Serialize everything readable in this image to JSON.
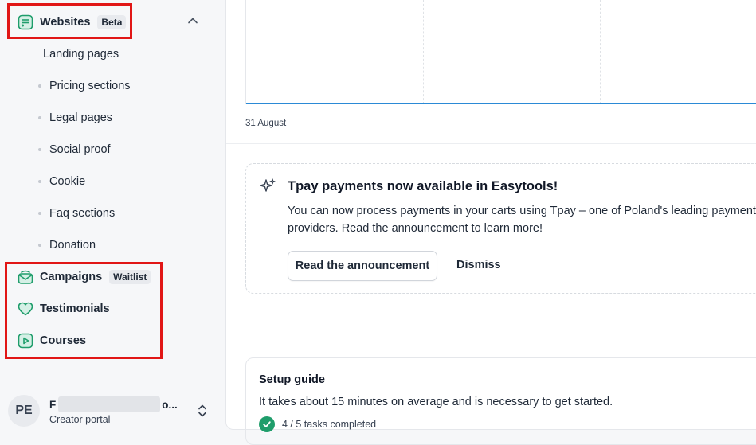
{
  "sidebar": {
    "websites": {
      "label": "Websites",
      "badge": "Beta"
    },
    "sub_items": [
      {
        "label": "Landing pages"
      },
      {
        "label": "Pricing sections"
      },
      {
        "label": "Legal pages"
      },
      {
        "label": "Social proof"
      },
      {
        "label": "Cookie"
      },
      {
        "label": "Faq sections"
      },
      {
        "label": "Donation"
      }
    ],
    "campaigns": {
      "label": "Campaigns",
      "badge": "Waitlist"
    },
    "testimonials": {
      "label": "Testimonials"
    },
    "courses": {
      "label": "Courses"
    },
    "account": {
      "initials": "PE",
      "name_start": "F",
      "name_end": "o...",
      "subtitle": "Creator portal"
    }
  },
  "chart": {
    "x_label": "31 August"
  },
  "announcement": {
    "title": "Tpay payments now available in Easytools!",
    "body": "You can now process payments in your carts using Tpay – one of Poland's leading payment providers. Read the announcement to learn more!",
    "read_button": "Read the announcement",
    "dismiss_button": "Dismiss"
  },
  "setup_guide": {
    "title": "Setup guide",
    "description": "It takes about 15 minutes on average and is necessary to get started.",
    "progress": "4 / 5 tasks completed"
  },
  "colors": {
    "accent": "#1f9d6b",
    "highlight": "#e11616",
    "chart_line": "#2b8ad6"
  }
}
